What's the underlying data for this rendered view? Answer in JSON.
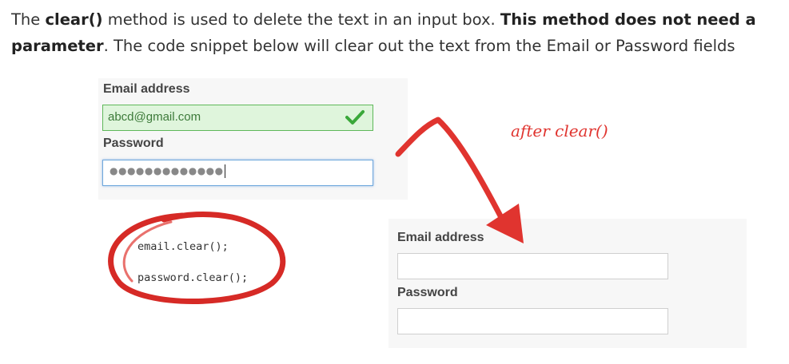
{
  "intro": {
    "p1": "The ",
    "p2": "clear()",
    "p3": " method is used to delete the text in an input box. ",
    "p4": "This method does not need a parameter",
    "p5": ". The code snippet below will clear out the text from the Email or Password fields"
  },
  "before_form": {
    "email_label": "Email address",
    "email_value": "abcd@gmail.com",
    "password_label": "Password",
    "password_masked": "●●●●●●●●●●●●●"
  },
  "code": {
    "line1": "email.clear();",
    "line2": "password.clear();"
  },
  "annotation": {
    "text": "after clear()"
  },
  "after_form": {
    "email_label": "Email address",
    "email_value": "",
    "password_label": "Password",
    "password_value": ""
  },
  "colors": {
    "annotation_red": "#e0342f",
    "valid_green_bg": "#dff5dc",
    "valid_green_border": "#5fb85a",
    "focus_blue": "#6fa8dc",
    "panel_bg": "#f7f7f7"
  },
  "icons": [
    "check-icon",
    "arrow-icon",
    "circle-highlight"
  ]
}
